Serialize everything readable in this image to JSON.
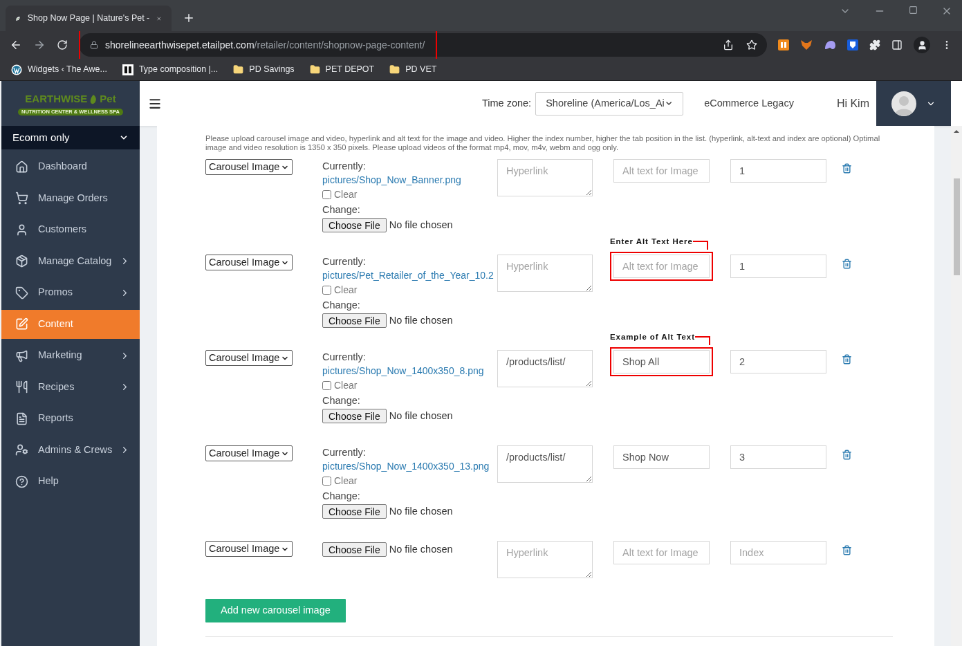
{
  "browser": {
    "tab_title": "Shop Now Page | Nature's Pet -",
    "address": {
      "domain": "shorelineearthwisepet.etailpet.com",
      "path": "/retailer/content/shopnow-page-content/",
      "highlighted": true
    },
    "bookmarks": [
      {
        "label": "Widgets ‹ The Awe...",
        "kind": "wordpress"
      },
      {
        "label": "Type composition |...",
        "kind": "badge"
      },
      {
        "label": "PD Savings",
        "kind": "folder"
      },
      {
        "label": "PET DEPOT",
        "kind": "folder"
      },
      {
        "label": "PD VET",
        "kind": "folder"
      }
    ]
  },
  "sidebar": {
    "logo": {
      "name": "EARTHWISE",
      "name2": "Pet",
      "tagline": "NUTRITION CENTER & WELLNESS SPA"
    },
    "store": "Ecomm only",
    "items": [
      {
        "label": "Dashboard",
        "has_submenu": false,
        "selected": false
      },
      {
        "label": "Manage Orders",
        "has_submenu": false,
        "selected": false
      },
      {
        "label": "Customers",
        "has_submenu": false,
        "selected": false
      },
      {
        "label": "Manage Catalog",
        "has_submenu": true,
        "selected": false
      },
      {
        "label": "Promos",
        "has_submenu": true,
        "selected": false
      },
      {
        "label": "Content",
        "has_submenu": false,
        "selected": true
      },
      {
        "label": "Marketing",
        "has_submenu": true,
        "selected": false
      },
      {
        "label": "Recipes",
        "has_submenu": true,
        "selected": false
      },
      {
        "label": "Reports",
        "has_submenu": false,
        "selected": false
      },
      {
        "label": "Admins & Crews",
        "has_submenu": true,
        "selected": false
      },
      {
        "label": "Help",
        "has_submenu": false,
        "selected": false
      }
    ]
  },
  "header": {
    "timezone_label": "Time zone:",
    "timezone_value": "Shoreline (America/Los_Ai",
    "legacy": "eCommerce Legacy",
    "greeting": "Hi Kim"
  },
  "content": {
    "instructions": "Please upload carousel image and video, hyperlink and alt text for the image and video. Higher the index number, higher the tab position in the list. (hyperlink, alt-text and index are optional) Optimal image and video resolution is 1350 x 350 pixels. Please upload videos of the format mp4, mov, m4v, webm and ogg only.",
    "rows": [
      {
        "type": "Carousel Image",
        "current": {
          "label": "Currently:",
          "file": "pictures/Shop_Now_Banner.png",
          "clear": "Clear",
          "clear_checked": false,
          "change": "Change:"
        },
        "choose": "Choose File",
        "file_status": "No file chosen",
        "hyperlink": {
          "placeholder": "Hyperlink"
        },
        "alt_text": {
          "placeholder": "Alt text for Image"
        },
        "index": {
          "value": "1"
        }
      },
      {
        "type": "Carousel Image",
        "current": {
          "label": "Currently:",
          "file": "pictures/Pet_Retailer_of_the_Year_10.2",
          "clear": "Clear",
          "clear_checked": false,
          "change": "Change:"
        },
        "choose": "Choose File",
        "file_status": "No file chosen",
        "hyperlink": {
          "placeholder": "Hyperlink"
        },
        "alt_text": {
          "placeholder": "Alt text for Image"
        },
        "index": {
          "value": "1"
        },
        "callout": "Enter Alt Text Here"
      },
      {
        "type": "Carousel Image",
        "current": {
          "label": "Currently:",
          "file": "pictures/Shop_Now_1400x350_8.png",
          "clear": "Clear",
          "clear_checked": false,
          "change": "Change:"
        },
        "choose": "Choose File",
        "file_status": "No file chosen",
        "hyperlink": {
          "value": "/products/list/"
        },
        "alt_text": {
          "value": "Shop All"
        },
        "index": {
          "value": "2"
        },
        "callout": "Example of Alt Text"
      },
      {
        "type": "Carousel Image",
        "current": {
          "label": "Currently:",
          "file": "pictures/Shop_Now_1400x350_13.png",
          "clear": "Clear",
          "clear_checked": false,
          "change": "Change:"
        },
        "choose": "Choose File",
        "file_status": "No file chosen",
        "hyperlink": {
          "value": "/products/list/"
        },
        "alt_text": {
          "value": "Shop Now"
        },
        "index": {
          "value": "3"
        }
      },
      {
        "type": "Carousel Image",
        "choose": "Choose File",
        "file_status": "No file chosen",
        "hyperlink": {
          "placeholder": "Hyperlink"
        },
        "alt_text": {
          "placeholder": "Alt text for Image"
        },
        "index": {
          "placeholder": "Index"
        }
      }
    ],
    "add_button": "Add new carousel image"
  }
}
